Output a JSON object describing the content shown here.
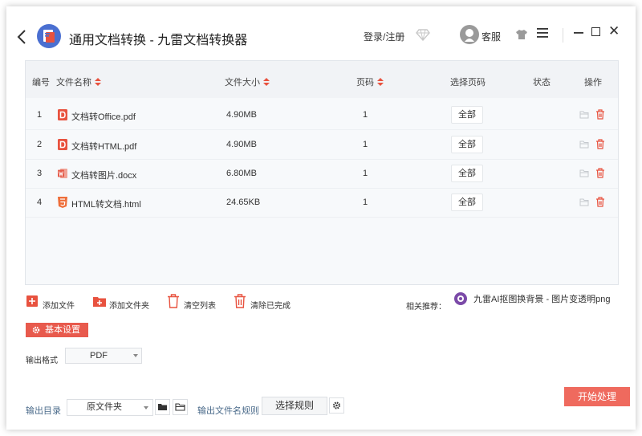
{
  "header": {
    "title": "通用文档转换 - 九雷文档转换器",
    "login_label": "登录/注册",
    "service_label": "客服"
  },
  "table": {
    "columns": {
      "index": "编号",
      "name": "文件名称",
      "size": "文件大小",
      "pages": "页码",
      "select_pages": "选择页码",
      "status": "状态",
      "actions": "操作"
    },
    "rows": [
      {
        "index": "1",
        "name": "文档转Office.pdf",
        "size": "4.90MB",
        "pages": "1",
        "select": "全部",
        "icon": "pdf-file-icon",
        "status": ""
      },
      {
        "index": "2",
        "name": "文档转HTML.pdf",
        "size": "4.90MB",
        "pages": "1",
        "select": "全部",
        "icon": "pdf-file-icon",
        "status": ""
      },
      {
        "index": "3",
        "name": "文档转图片.docx",
        "size": "6.80MB",
        "pages": "1",
        "select": "全部",
        "icon": "word-file-icon",
        "status": ""
      },
      {
        "index": "4",
        "name": "HTML转文档.html",
        "size": "24.65KB",
        "pages": "1",
        "select": "全部",
        "icon": "html5-file-icon",
        "status": ""
      }
    ]
  },
  "toolbar": {
    "add_file": "添加文件",
    "add_folder": "添加文件夹",
    "clear_list": "清空列表",
    "clear_done": "清除已完成"
  },
  "recommend": {
    "label": "相关推荐：",
    "link": "九雷AI抠图换背景 - 图片变透明png"
  },
  "settings": {
    "button": "基本设置",
    "format_label": "输出格式",
    "format_value": "PDF",
    "output_label": "输出目录",
    "output_value": "原文件夹",
    "rule_label": "输出文件名规则",
    "rule_button": "选择规则"
  },
  "start_button": "开始处理",
  "colors": {
    "accent_red": "#e85a4d",
    "start_red": "#ef6a5e",
    "pdf_red": "#e8523f",
    "word_red": "#e45b4a",
    "html_orange": "#ee6e3a"
  }
}
